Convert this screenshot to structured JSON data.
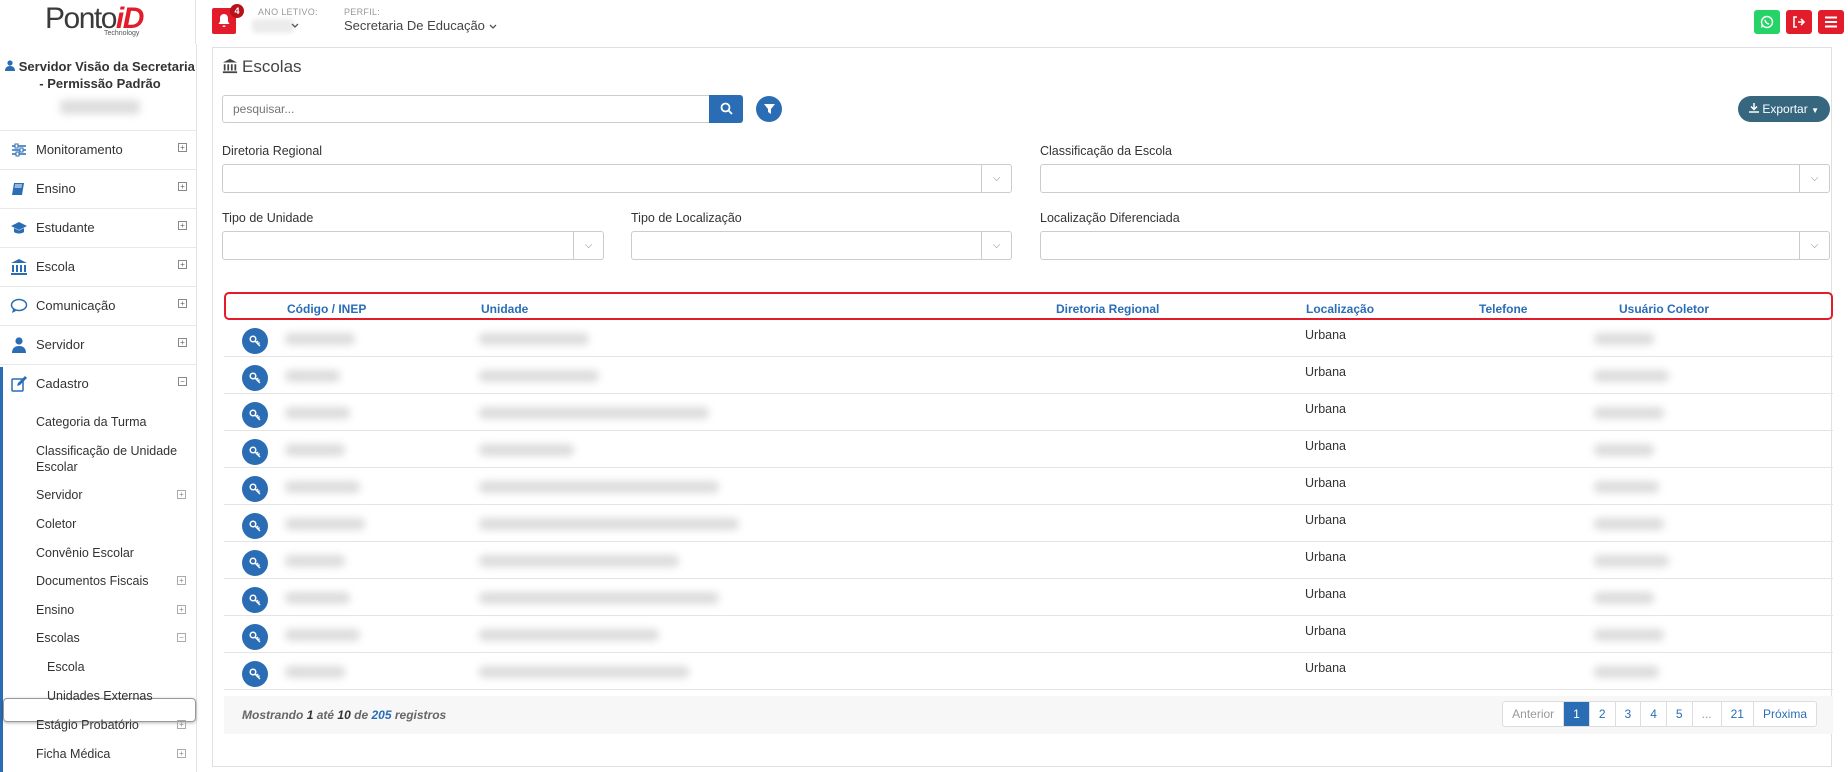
{
  "brand": {
    "name_part1": "Ponto",
    "name_part2": "iD",
    "tagline": "Technology"
  },
  "header": {
    "notifications_count": "4",
    "ano_letivo_label": "ANO LETIVO:",
    "perfil_label": "PERFIL:",
    "perfil_value": "Secretaria De Educação",
    "colors": {
      "whatsapp": "#25d366",
      "logout": "#e21c2a",
      "menu": "#e21c2a"
    }
  },
  "sidebar": {
    "user_name": "Servidor Visão da Secretaria - Permissão Padrão",
    "items": [
      {
        "label": "Monitoramento",
        "icon": "sliders-icon"
      },
      {
        "label": "Ensino",
        "icon": "book-icon"
      },
      {
        "label": "Estudante",
        "icon": "graduation-cap-icon"
      },
      {
        "label": "Escola",
        "icon": "institution-icon"
      },
      {
        "label": "Comunicação",
        "icon": "chat-bubble-icon"
      },
      {
        "label": "Servidor",
        "icon": "user-icon"
      },
      {
        "label": "Cadastro",
        "icon": "edit-icon"
      }
    ],
    "cadastro_sub": [
      {
        "label": "Categoria da Turma",
        "expand": false
      },
      {
        "label": "Classificação de Unidade Escolar",
        "expand": false
      },
      {
        "label": "Servidor",
        "expand": true
      },
      {
        "label": "Coletor",
        "expand": false
      },
      {
        "label": "Convênio Escolar",
        "expand": false
      },
      {
        "label": "Documentos Fiscais",
        "expand": true
      },
      {
        "label": "Ensino",
        "expand": true
      },
      {
        "label": "Escolas",
        "expand": true
      },
      {
        "label": "Escola",
        "expand": false
      },
      {
        "label": "Unidades Externas",
        "expand": false
      },
      {
        "label": "Estágio Probatório",
        "expand": true
      },
      {
        "label": "Ficha Médica",
        "expand": true
      }
    ]
  },
  "page": {
    "title": "Escolas",
    "search_placeholder": "pesquisar...",
    "export_label": "Exportar",
    "filters": {
      "diretoria_regional": "Diretoria Regional",
      "classificacao": "Classificação da Escola",
      "tipo_unidade": "Tipo de Unidade",
      "tipo_localizacao": "Tipo de Localização",
      "localizacao_diferenciada": "Localização Diferenciada"
    }
  },
  "table": {
    "columns": [
      "Código / INEP",
      "Unidade",
      "Diretoria Regional",
      "Localização",
      "Telefone",
      "Usuário Coletor"
    ],
    "rows": [
      {
        "localizacao": "Urbana"
      },
      {
        "localizacao": "Urbana"
      },
      {
        "localizacao": "Urbana"
      },
      {
        "localizacao": "Urbana"
      },
      {
        "localizacao": "Urbana"
      },
      {
        "localizacao": "Urbana"
      },
      {
        "localizacao": "Urbana"
      },
      {
        "localizacao": "Urbana"
      },
      {
        "localizacao": "Urbana"
      },
      {
        "localizacao": "Urbana"
      }
    ],
    "footer": {
      "mostrando": "Mostrando",
      "from": "1",
      "ate": "até",
      "to": "10",
      "de": "de",
      "total": "205",
      "registros": "registros"
    },
    "pagination": [
      "Anterior",
      "1",
      "2",
      "3",
      "4",
      "5",
      "...",
      "21",
      "Próxima"
    ],
    "active_page": "1"
  }
}
